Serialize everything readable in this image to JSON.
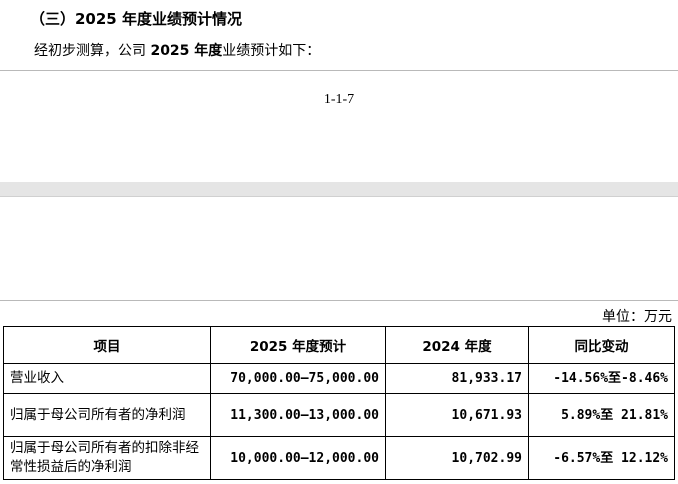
{
  "section_heading": "（三）2025 年度业绩预计情况",
  "intro": {
    "prefix": "经初步测算，公司 ",
    "bold": "2025 年度",
    "suffix": "业绩预计如下："
  },
  "page_number": "1-1-7",
  "unit_label": "单位：万元",
  "table": {
    "headers": [
      "项目",
      "2025 年度预计",
      "2024 年度",
      "同比变动"
    ],
    "rows": [
      {
        "item": "营业收入",
        "forecast": "70,000.00–75,000.00",
        "prior": "81,933.17",
        "change": "-14.56%至-8.46%"
      },
      {
        "item": "归属于母公司所有者的净利润",
        "forecast": "11,300.00–13,000.00",
        "prior": "10,671.93",
        "change": "5.89%至 21.81%"
      },
      {
        "item": "归属于母公司所有者的扣除非经常性损益后的净利润",
        "forecast": "10,000.00–12,000.00",
        "prior": "10,702.99",
        "change": "-6.57%至 12.12%"
      }
    ]
  }
}
